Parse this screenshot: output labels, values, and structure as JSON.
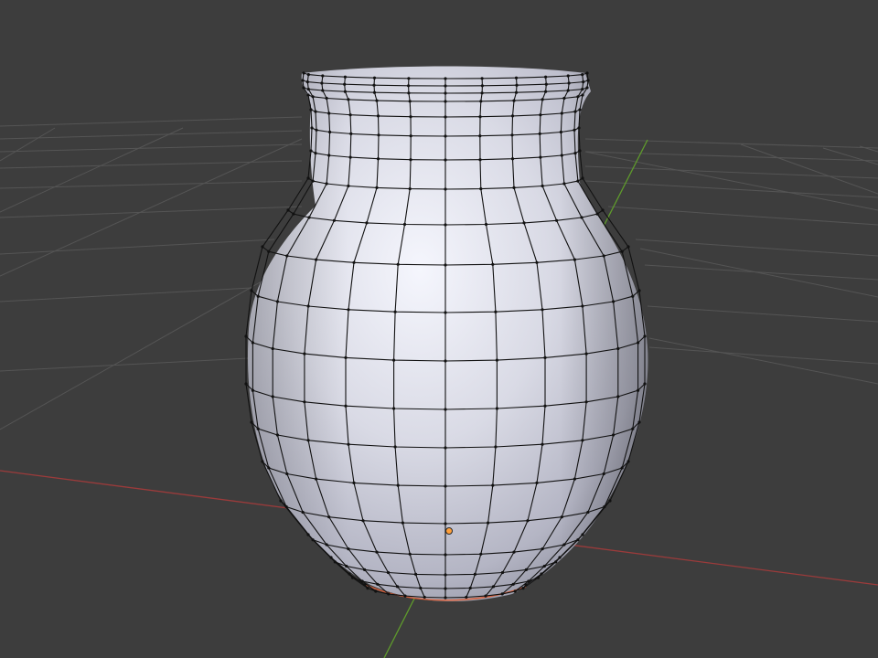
{
  "viewport": {
    "background": "#3d3d3d",
    "grid_color": "#545454",
    "x_axis_color": "#9b3b3b",
    "y_axis_color": "#5f9b2c",
    "object": {
      "type": "vase-mesh",
      "selected": true,
      "surface_color": "#cfd0da",
      "wire_color": "#111111",
      "origin_color": "#ff9f3a"
    }
  }
}
